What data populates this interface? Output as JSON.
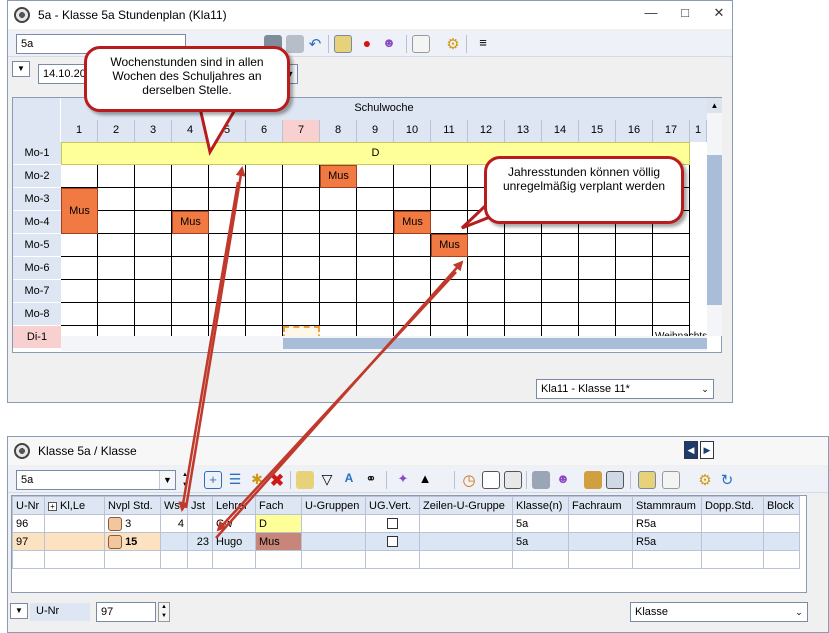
{
  "top_window": {
    "title": "5a - Klasse 5a  Stundenplan  (Kla11)",
    "element_combo": "5a",
    "date_combo": "14.10.20",
    "grid_title": "Schulwoche",
    "weeks": [
      "1",
      "2",
      "3",
      "4",
      "5",
      "6",
      "7",
      "8",
      "9",
      "10",
      "11",
      "12",
      "13",
      "14",
      "15",
      "16",
      "17",
      "1"
    ],
    "highlight_week": "7",
    "rows": [
      "Mo-1",
      "Mo-2",
      "Mo-3",
      "Mo-4",
      "Mo-5",
      "Mo-6",
      "Mo-7",
      "Mo-8",
      "Di-1"
    ],
    "weekly_lesson": "D",
    "lessons": [
      {
        "label": "Mus",
        "row": "Mo-2",
        "week": "8"
      },
      {
        "label": "Mus",
        "row": "Mo-3",
        "week": "1"
      },
      {
        "label": "Mus",
        "row": "Mo-4",
        "week": "4"
      },
      {
        "label": "Mus",
        "row": "Mo-4",
        "week": "10"
      },
      {
        "label": "Mus",
        "row": "Mo-5",
        "week": "11"
      }
    ],
    "holiday_label": "Weihnachts",
    "format_combo": "Kla11 - Klasse 11*"
  },
  "callouts": {
    "weekly": "Wochenstunden sind in allen Wochen des Schuljahres an derselben Stelle.",
    "yearly": "Jahresstunden können völlig unregelmäßig verplant werden"
  },
  "bottom_window": {
    "title": "Klasse 5a / Klasse",
    "element_combo": "5a",
    "headers": [
      "U-Nr",
      "Kl,Le",
      "Nvpl Std.",
      "Wst",
      "Jst",
      "Lehrer",
      "Fach",
      "U-Gruppen",
      "UG.Vert.",
      "Zeilen-U-Gruppe",
      "Klasse(n)",
      "Fachraum",
      "Stammraum",
      "Dopp.Std.",
      "Block"
    ],
    "rows": [
      {
        "unr": "96",
        "nvpl": "3",
        "wst": "4",
        "jst": "",
        "lehrer": "Gw",
        "fach": "D",
        "klasse": "5a",
        "stammraum": "R5a"
      },
      {
        "unr": "97",
        "nvpl": "15",
        "wst": "",
        "jst": "23",
        "lehrer": "Hugo",
        "fach": "Mus",
        "klasse": "5a",
        "stammraum": "R5a"
      }
    ],
    "footer_label": "U-Nr",
    "footer_value": "97",
    "footer_combo": "Klasse"
  },
  "colors": {
    "lesson_orange": "#f07a42",
    "weekly_yellow": "#ffff99",
    "callout_red": "#b81c1c",
    "header_blue": "#dde6f2"
  }
}
